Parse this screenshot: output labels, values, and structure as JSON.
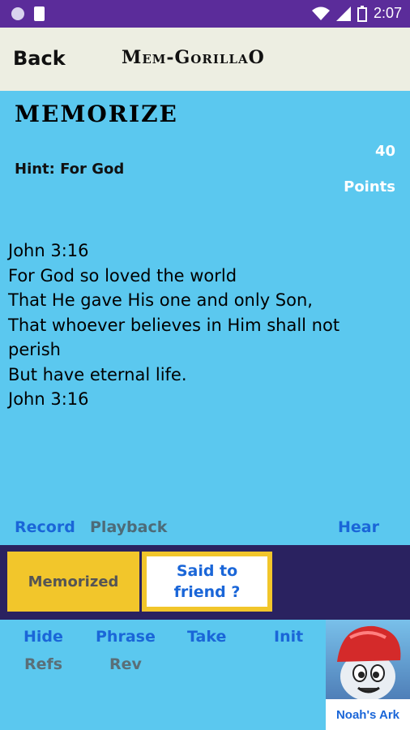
{
  "status": {
    "time": "2:07"
  },
  "appbar": {
    "back_label": "Back",
    "title": "Mem-GorillaO"
  },
  "main": {
    "heading": "MEMORIZE",
    "hint": "Hint: For God",
    "points_value": "40",
    "points_label": "Points",
    "verse_text": "John 3:16\nFor God so loved the world\nThat He gave His one and only Son,\nThat whoever believes in Him shall not\nperish\nBut have eternal life.\nJohn 3:16"
  },
  "audio_actions": {
    "record": "Record",
    "playback": "Playback",
    "hear": "Hear"
  },
  "buttons": {
    "memorized": "Memorized",
    "said_to_friend": "Said to\nfriend ?"
  },
  "bottom_nav": {
    "hide": "Hide",
    "phrase": "Phrase",
    "take": "Take",
    "init": "Init",
    "refs": "Refs",
    "rev": "Rev"
  },
  "ad": {
    "caption": "Noah's Ark"
  },
  "colors": {
    "accent": "#5BC8EF",
    "status_bar": "#5B2C9A",
    "band": "#2A2260",
    "button_yellow": "#F2C62B",
    "link_blue": "#1A66D8"
  }
}
